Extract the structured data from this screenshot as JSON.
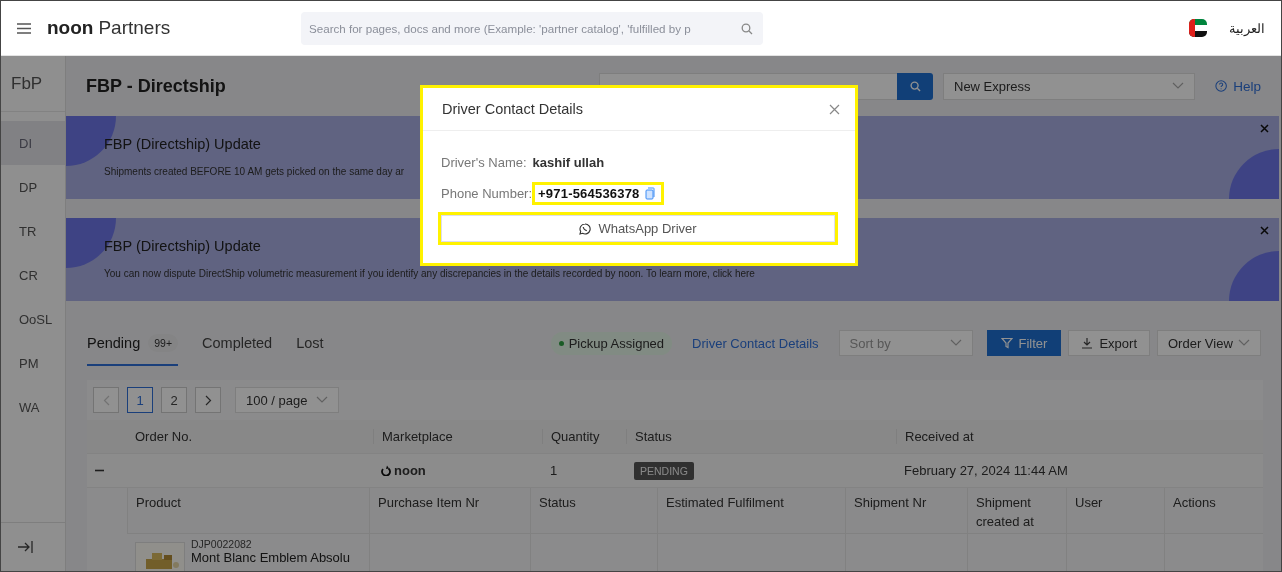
{
  "header": {
    "logo_bold": "noon",
    "logo_text": "Partners",
    "search": {
      "placeholder": "Search for pages, docs and more (Example: 'partner catalog', 'fulfilled by p"
    },
    "language": "العربية"
  },
  "sidebar": {
    "title": "FbP",
    "items": [
      {
        "label": "DI",
        "selected": true
      },
      {
        "label": "DP",
        "selected": false
      },
      {
        "label": "TR",
        "selected": false
      },
      {
        "label": "CR",
        "selected": false
      },
      {
        "label": "OoSL",
        "selected": false
      },
      {
        "label": "PM",
        "selected": false
      },
      {
        "label": "WA",
        "selected": false
      }
    ]
  },
  "page": {
    "title": "FBP - Directship",
    "marketplace_select": "New Express",
    "help": "Help"
  },
  "banners": [
    {
      "title": "FBP (Directship) Update",
      "text": "Shipments created BEFORE 10 AM gets picked on the same day ar"
    },
    {
      "title": "FBP (Directship) Update",
      "text": "You can now dispute DirectShip volumetric measurement if you identify any discrepancies in the details recorded by noon. To learn more, click here"
    }
  ],
  "tabs": [
    {
      "label": "Pending",
      "count": "99+",
      "selected": true
    },
    {
      "label": "Completed",
      "selected": false
    },
    {
      "label": "Lost",
      "selected": false
    }
  ],
  "toolbar": {
    "status_pill": "Pickup Assigned",
    "driver_link": "Driver Contact Details",
    "sort": {
      "placeholder": "Sort by"
    },
    "filter": "Filter",
    "export": "Export",
    "view": "Order View"
  },
  "pagination": {
    "prev_disabled": true,
    "pages": [
      {
        "label": "1",
        "selected": true
      },
      {
        "label": "2",
        "selected": false
      }
    ],
    "page_size": "100 / page"
  },
  "table": {
    "columns": [
      "Order No.",
      "Marketplace",
      "Quantity",
      "Status",
      "Received at"
    ],
    "rows": [
      {
        "expanded": true,
        "marketplace": "noon",
        "quantity": "1",
        "status": "PENDING",
        "received_at": "February 27, 2024 11:44 AM"
      }
    ]
  },
  "subtable": {
    "columns": [
      "Product",
      "Purchase Item Nr",
      "Status",
      "Estimated Fulfilment",
      "Shipment Nr",
      "Shipment created at",
      "User",
      "Actions"
    ],
    "rows": [
      {
        "product_id": "DJP0022082",
        "product_name": "Mont Blanc Emblem Absolu"
      }
    ]
  },
  "modal": {
    "title": "Driver Contact Details",
    "fields": [
      {
        "kind": "name",
        "label": "Driver's Name:",
        "value": "kashif ullah"
      },
      {
        "kind": "phone",
        "label": "Phone Number:",
        "value": "+971-564536378"
      }
    ],
    "whatsapp_button": "WhatsApp Driver"
  }
}
